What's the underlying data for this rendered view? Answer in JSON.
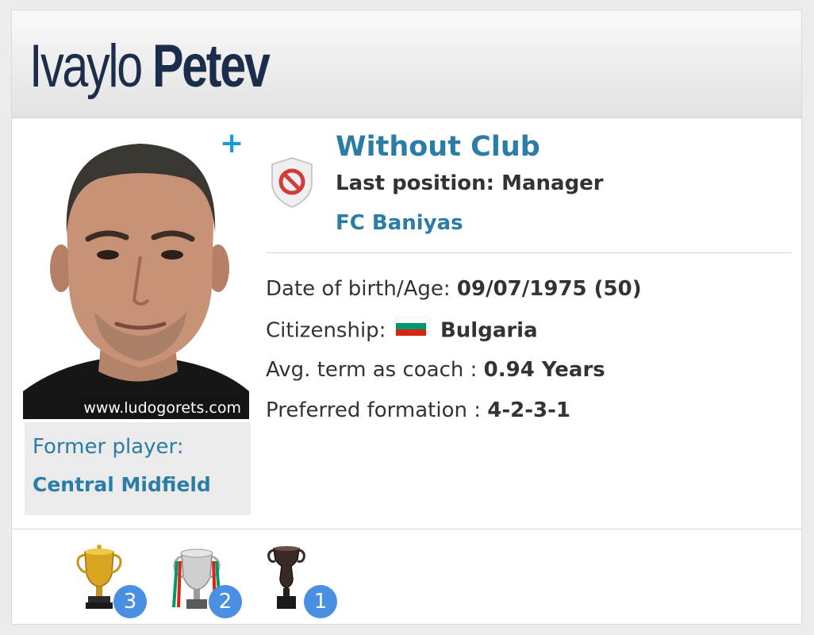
{
  "player": {
    "first_name": "Ivaylo",
    "last_name": "Petev"
  },
  "photo": {
    "watermark": "www.ludogorets.com",
    "expand_symbol": "+"
  },
  "former_player": {
    "label": "Former player:",
    "position": "Central Midfield"
  },
  "club_status": {
    "status": "Without Club",
    "last_position": "Last position: Manager",
    "club": "FC Baniyas",
    "icon": "no-club-shield-icon"
  },
  "info": {
    "dob_label": "Date of birth/Age:",
    "dob_value": "09/07/1975 (50)",
    "citizenship_label": "Citizenship:",
    "citizenship_value": "Bulgaria",
    "citizenship_flag": "bulgaria-flag-icon",
    "term_label": "Avg. term as coach :",
    "term_value": "0.94 Years",
    "formation_label": "Preferred formation :",
    "formation_value": "4-2-3-1"
  },
  "trophies": [
    {
      "icon": "gold-cup-icon",
      "count": "3"
    },
    {
      "icon": "national-cup-icon",
      "count": "2"
    },
    {
      "icon": "dark-cup-icon",
      "count": "1"
    }
  ],
  "colors": {
    "accent": "#2b7ca6",
    "name": "#1c2d4b",
    "badge": "#4a90e2"
  }
}
